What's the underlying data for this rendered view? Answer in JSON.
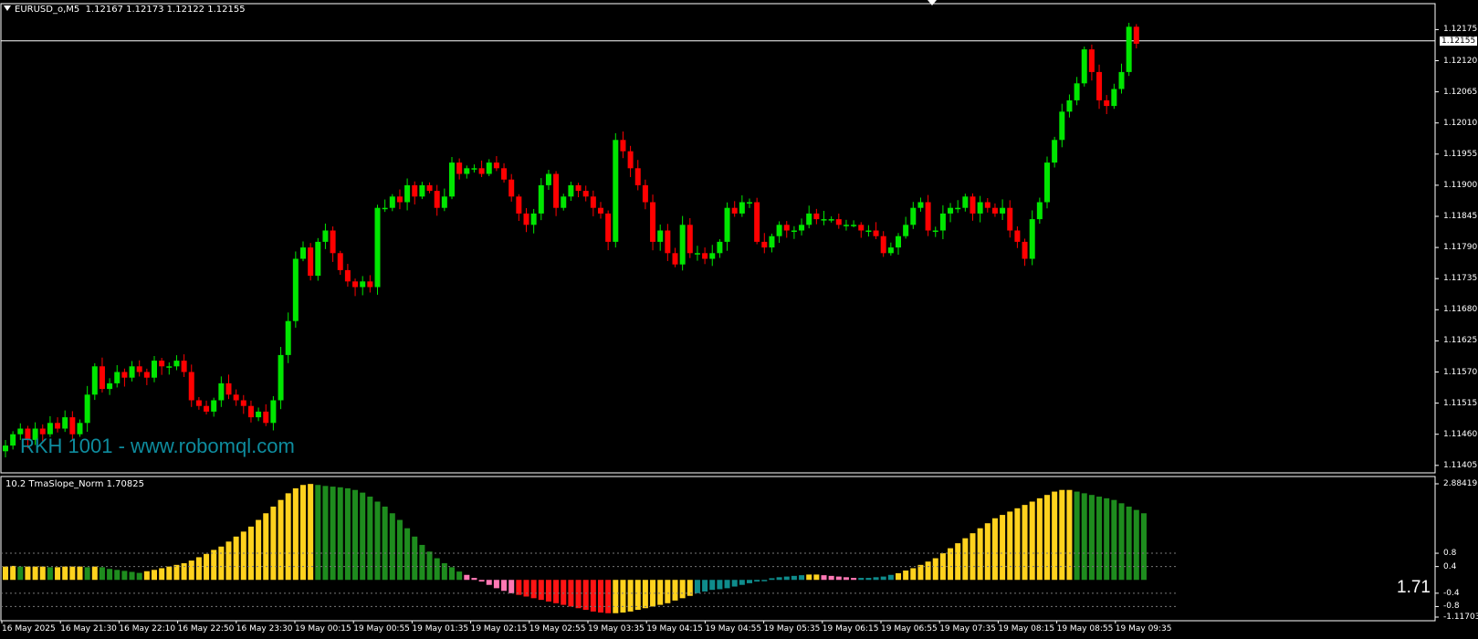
{
  "header": {
    "symbol": "EURUSD_o,M5",
    "ohlc": "1.12167 1.12173 1.12122 1.12155"
  },
  "watermark": "RKH 1001 - www.robomql.com",
  "current_price": "1.12155",
  "price_axis": [
    "1.12175",
    "1.12120",
    "1.12065",
    "1.12010",
    "1.11955",
    "1.11900",
    "1.11845",
    "1.11790",
    "1.11735",
    "1.11680",
    "1.11625",
    "1.11570",
    "1.11515",
    "1.11460",
    "1.11405"
  ],
  "indicator": {
    "name": "10.2 TmaSlope_Norm 1.70825",
    "big_value": "1.71",
    "axis": [
      "2.88419",
      "0.8",
      "0.4",
      "-0.4",
      "-0.8",
      "-1.11703"
    ]
  },
  "time_axis": [
    "16 May 2025",
    "16 May 21:30",
    "16 May 22:10",
    "16 May 22:50",
    "16 May 23:30",
    "19 May 00:15",
    "19 May 00:55",
    "19 May 01:35",
    "19 May 02:15",
    "19 May 02:55",
    "19 May 03:35",
    "19 May 04:15",
    "19 May 04:55",
    "19 May 05:35",
    "19 May 06:15",
    "19 May 06:55",
    "19 May 07:35",
    "19 May 08:15",
    "19 May 08:55",
    "19 May 09:35"
  ],
  "colors": {
    "background": "#000000",
    "bull": "#00e600",
    "bear": "#ff0000",
    "hist_yellow": "#ffd21e",
    "hist_green": "#1e8c1e",
    "hist_red": "#ff1414",
    "hist_pink": "#ff78b4",
    "hist_teal": "#0f8c8c",
    "watermark": "#0e8c9e"
  },
  "chart_data": {
    "type": "candlestick",
    "symbol": "EURUSD_o",
    "timeframe": "M5",
    "price_range": [
      1.11395,
      1.12195
    ],
    "candle_closes": [
      1.1144,
      1.1146,
      1.1147,
      1.1145,
      1.1147,
      1.1146,
      1.1148,
      1.1147,
      1.1149,
      1.1146,
      1.1148,
      1.1153,
      1.1158,
      1.1154,
      1.1155,
      1.1157,
      1.1156,
      1.1158,
      1.1157,
      1.1156,
      1.1159,
      1.1158,
      1.1158,
      1.1159,
      1.1157,
      1.1152,
      1.1151,
      1.115,
      1.1152,
      1.1155,
      1.1153,
      1.1152,
      1.1151,
      1.1149,
      1.115,
      1.1148,
      1.1152,
      1.116,
      1.1166,
      1.1177,
      1.1179,
      1.1174,
      1.118,
      1.1182,
      1.1178,
      1.1175,
      1.1173,
      1.1172,
      1.1173,
      1.1172,
      1.1186,
      1.1186,
      1.1188,
      1.1187,
      1.119,
      1.1188,
      1.119,
      1.1189,
      1.1186,
      1.1188,
      1.1194,
      1.1192,
      1.1193,
      1.1193,
      1.1192,
      1.1194,
      1.1193,
      1.1191,
      1.1188,
      1.1185,
      1.1183,
      1.1185,
      1.119,
      1.1192,
      1.1186,
      1.1188,
      1.119,
      1.1189,
      1.1188,
      1.1186,
      1.1185,
      1.118,
      1.1198,
      1.1196,
      1.1193,
      1.119,
      1.1187,
      1.118,
      1.1182,
      1.1178,
      1.1176,
      1.1183,
      1.1178,
      1.1178,
      1.1177,
      1.1178,
      1.118,
      1.1186,
      1.1185,
      1.1187,
      1.1187,
      1.118,
      1.1179,
      1.1181,
      1.1183,
      1.1182,
      1.1182,
      1.1183,
      1.1185,
      1.1184,
      1.1184,
      1.1184,
      1.1183,
      1.1183,
      1.1183,
      1.1182,
      1.1182,
      1.1181,
      1.1178,
      1.1179,
      1.1181,
      1.1183,
      1.1186,
      1.1187,
      1.1182,
      1.1182,
      1.1185,
      1.1186,
      1.1186,
      1.1188,
      1.1185,
      1.1187,
      1.1186,
      1.1185,
      1.1186,
      1.1182,
      1.118,
      1.1177,
      1.1184,
      1.1187,
      1.1194,
      1.1198,
      1.1203,
      1.1205,
      1.1208,
      1.1214,
      1.121,
      1.1205,
      1.1204,
      1.1207,
      1.121,
      1.1218,
      1.1215
    ],
    "candle_count": 152,
    "indicator_series": {
      "name": "TmaSlope_Norm",
      "value_range": [
        -1.11703,
        2.88419
      ],
      "values": [
        0.4,
        0.42,
        0.4,
        0.4,
        0.4,
        0.4,
        0.38,
        0.38,
        0.4,
        0.4,
        0.4,
        0.38,
        0.4,
        0.38,
        0.33,
        0.3,
        0.27,
        0.24,
        0.21,
        0.26,
        0.3,
        0.35,
        0.4,
        0.45,
        0.5,
        0.58,
        0.68,
        0.78,
        0.9,
        1.0,
        1.15,
        1.3,
        1.45,
        1.6,
        1.8,
        2.0,
        2.2,
        2.4,
        2.6,
        2.75,
        2.85,
        2.88,
        2.85,
        2.82,
        2.8,
        2.78,
        2.75,
        2.7,
        2.62,
        2.5,
        2.35,
        2.2,
        2.0,
        1.8,
        1.55,
        1.3,
        1.05,
        0.85,
        0.65,
        0.5,
        0.38,
        0.25,
        0.15,
        0.06,
        -0.05,
        -0.15,
        -0.25,
        -0.33,
        -0.4,
        -0.45,
        -0.5,
        -0.55,
        -0.6,
        -0.65,
        -0.7,
        -0.75,
        -0.8,
        -0.85,
        -0.9,
        -0.95,
        -0.98,
        -1.0,
        -1.0,
        -0.98,
        -0.95,
        -0.9,
        -0.85,
        -0.8,
        -0.75,
        -0.7,
        -0.62,
        -0.55,
        -0.48,
        -0.4,
        -0.35,
        -0.3,
        -0.28,
        -0.25,
        -0.2,
        -0.15,
        -0.1,
        -0.05,
        0.0,
        0.05,
        0.08,
        0.1,
        0.12,
        0.14,
        0.16,
        0.16,
        0.14,
        0.12,
        0.1,
        0.08,
        0.06,
        0.06,
        0.06,
        0.08,
        0.1,
        0.15,
        0.2,
        0.28,
        0.35,
        0.45,
        0.55,
        0.65,
        0.8,
        0.95,
        1.1,
        1.25,
        1.4,
        1.55,
        1.7,
        1.85,
        1.95,
        2.05,
        2.15,
        2.25,
        2.35,
        2.45,
        2.55,
        2.65,
        2.7,
        2.7,
        2.65,
        2.6,
        2.55,
        2.5,
        2.45,
        2.4,
        2.3,
        2.2,
        2.1,
        2.0
      ]
    }
  }
}
